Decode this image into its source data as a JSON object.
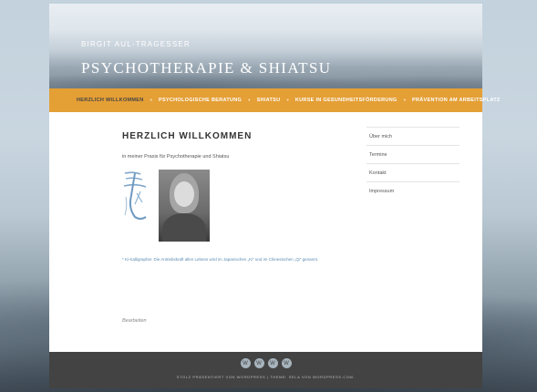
{
  "header": {
    "site_description": "BIRGIT AUL-TRAGESSER",
    "site_title": "PSYCHOTHERAPIE & SHIATSU"
  },
  "nav": {
    "items": [
      {
        "label": "HERZLICH WILLKOMMEN"
      },
      {
        "label": "PSYCHOLOGISCHE BERATUNG"
      },
      {
        "label": "SHIATSU"
      },
      {
        "label": "KURSE IN GESUNDHEITSFÖRDERUNG"
      },
      {
        "label": "PRÄVENTION AM ARBEITSPLATZ"
      }
    ],
    "separator": "•",
    "active_index": 0
  },
  "main": {
    "page_title": "HERZLICH WILLKOMMEN",
    "intro": "in meiner Praxis für Psychotherapie und Shiatsu",
    "caption": "* Ki-Kalligraphie: Die Antriebskraft allen Lebens wird im Japanischen „Ki“ und im Chinesischen „Qi“ genannt.",
    "edit_link": "Bearbeiten"
  },
  "sidebar": {
    "items": [
      {
        "label": "Über mich"
      },
      {
        "label": "Termine"
      },
      {
        "label": "Kontakt"
      },
      {
        "label": "Impressum"
      }
    ]
  },
  "footer": {
    "social_icons": [
      "wordpress-icon",
      "wordpress-icon",
      "wordpress-icon",
      "wordpress-icon"
    ],
    "credit": "STOLZ PRÄSENTIERT VON WORDPRESS | THEME: SELA VON WORDPRESS.COM."
  },
  "colors": {
    "nav_bg": "#e49f35",
    "footer_bg": "#434343",
    "caption_text": "#5b8bb3"
  }
}
